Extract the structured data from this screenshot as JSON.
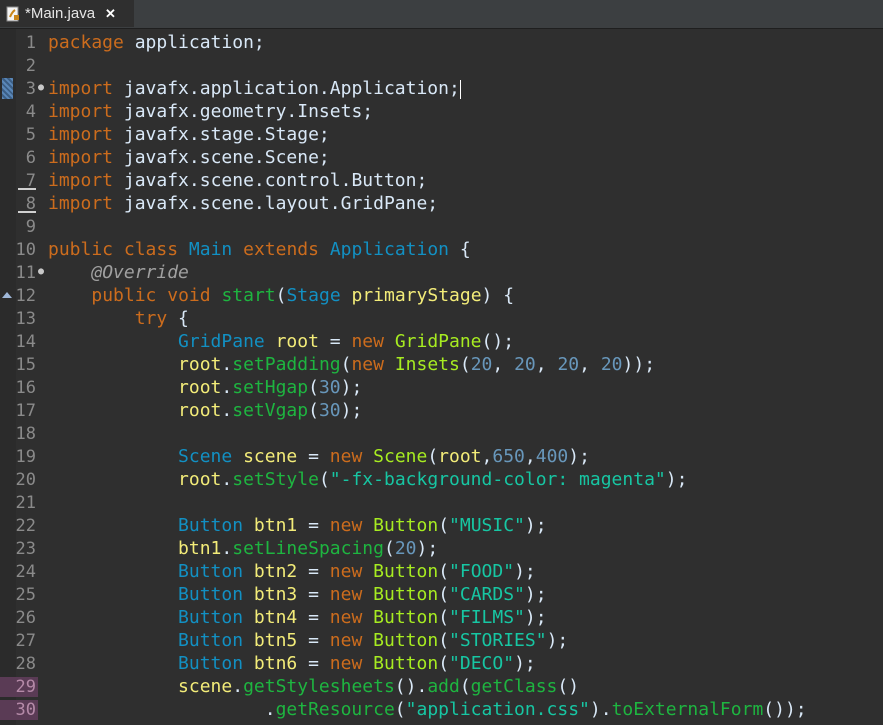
{
  "tab": {
    "icon": "java-file-icon",
    "title": "*Main.java",
    "close": "✕"
  },
  "colors": {
    "background": "#2f2f2f",
    "keyword": "#cc6c1d",
    "type": "#1290c3",
    "method": "#1eb540",
    "number": "#6897bb",
    "string": "#17c6a3",
    "variable": "#f3ec79",
    "annotation": "#a0a0a0"
  },
  "lines": [
    {
      "n": "1",
      "code": "package application;"
    },
    {
      "n": "2",
      "code": ""
    },
    {
      "n": "3",
      "code": "import javafx.application.Application;"
    },
    {
      "n": "4",
      "code": "import javafx.geometry.Insets;"
    },
    {
      "n": "5",
      "code": "import javafx.stage.Stage;"
    },
    {
      "n": "6",
      "code": "import javafx.scene.Scene;"
    },
    {
      "n": "7",
      "code": "import javafx.scene.control.Button;"
    },
    {
      "n": "8",
      "code": "import javafx.scene.layout.GridPane;"
    },
    {
      "n": "9",
      "code": ""
    },
    {
      "n": "10",
      "code": "public class Main extends Application {"
    },
    {
      "n": "11",
      "code": "    @Override"
    },
    {
      "n": "12",
      "code": "    public void start(Stage primaryStage) {"
    },
    {
      "n": "13",
      "code": "        try {"
    },
    {
      "n": "14",
      "code": "            GridPane root = new GridPane();"
    },
    {
      "n": "15",
      "code": "            root.setPadding(new Insets(20, 20, 20, 20));"
    },
    {
      "n": "16",
      "code": "            root.setHgap(30);"
    },
    {
      "n": "17",
      "code": "            root.setVgap(30);"
    },
    {
      "n": "18",
      "code": ""
    },
    {
      "n": "19",
      "code": "            Scene scene = new Scene(root,650,400);"
    },
    {
      "n": "20",
      "code": "            root.setStyle(\"-fx-background-color: magenta\");"
    },
    {
      "n": "21",
      "code": ""
    },
    {
      "n": "22",
      "code": "            Button btn1 = new Button(\"MUSIC\");"
    },
    {
      "n": "23",
      "code": "            btn1.setLineSpacing(20);"
    },
    {
      "n": "24",
      "code": "            Button btn2 = new Button(\"FOOD\");"
    },
    {
      "n": "25",
      "code": "            Button btn3 = new Button(\"CARDS\");"
    },
    {
      "n": "26",
      "code": "            Button btn4 = new Button(\"FILMS\");"
    },
    {
      "n": "27",
      "code": "            Button btn5 = new Button(\"STORIES\");"
    },
    {
      "n": "28",
      "code": "            Button btn6 = new Button(\"DECO\");"
    },
    {
      "n": "29",
      "code": "            scene.getStylesheets().add(getClass()"
    },
    {
      "n": "30",
      "code": "                    .getResource(\"application.css\").toExternalForm());"
    }
  ]
}
